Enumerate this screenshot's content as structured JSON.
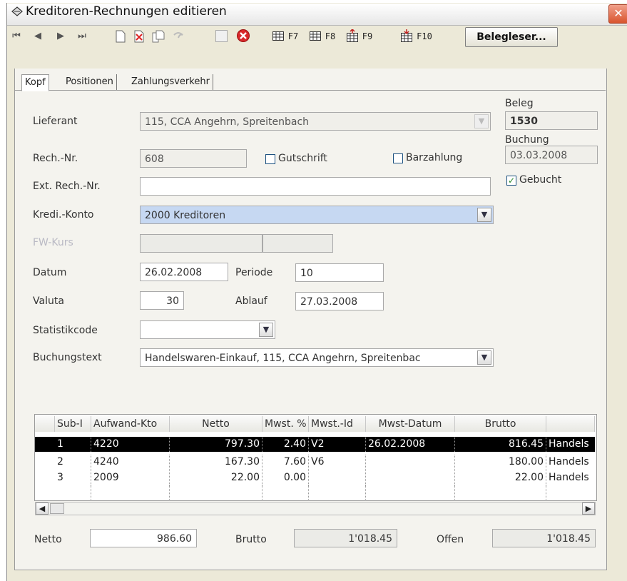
{
  "window": {
    "title": "Kreditoren-Rechnungen editieren",
    "close_symbol": "✕"
  },
  "toolbar": {
    "nav_first": "⏮",
    "nav_prev": "◀",
    "nav_next": "▶",
    "nav_last": "⏭",
    "f7": "F7",
    "f8": "F8",
    "f9": "F9",
    "f10": "F10",
    "beleg_button": "Belegleser..."
  },
  "tabs": [
    {
      "label": "Kopf",
      "active": true
    },
    {
      "label": "Positionen",
      "active": false
    },
    {
      "label": "Zahlungsverkehr",
      "active": false
    }
  ],
  "form": {
    "lieferant_label": "Lieferant",
    "lieferant_value": "115, CCA Angehrn, Spreitenbach",
    "rech_nr_label": "Rech.-Nr.",
    "rech_nr_value": "608",
    "gutschrift_label": "Gutschrift",
    "barzahlung_label": "Barzahlung",
    "ext_rech_nr_label": "Ext. Rech.-Nr.",
    "ext_rech_nr_value": "",
    "kredi_konto_label": "Kredi.-Konto",
    "kredi_konto_value": "2000 Kreditoren",
    "fw_kurs_label": "FW-Kurs",
    "datum_label": "Datum",
    "datum_value": "26.02.2008",
    "periode_label": "Periode",
    "periode_value": "10",
    "valuta_label": "Valuta",
    "valuta_value": "30",
    "ablauf_label": "Ablauf",
    "ablauf_value": "27.03.2008",
    "statistikcode_label": "Statistikcode",
    "statistikcode_value": "",
    "buchungstext_label": "Buchungstext",
    "buchungstext_value": "Handelswaren-Einkauf, 115, CCA Angehrn, Spreitenbac"
  },
  "side": {
    "beleg_label": "Beleg",
    "beleg_value": "1530",
    "buchung_label": "Buchung",
    "buchung_value": "03.03.2008",
    "gebucht_label": "Gebucht",
    "gebucht_checked": true
  },
  "grid": {
    "columns": [
      "Sub-I",
      "Aufwand-Kto",
      "Netto",
      "Mwst. %",
      "Mwst.-Id",
      "Mwst-Datum",
      "Brutto",
      ""
    ],
    "rows": [
      {
        "sub": "1",
        "konto": "4220",
        "netto": "797.30",
        "mwst": "2.40",
        "mwst_id": "V2",
        "datum": "26.02.2008",
        "brutto": "816.45",
        "text": "Handels",
        "selected": true
      },
      {
        "sub": "2",
        "konto": "4240",
        "netto": "167.30",
        "mwst": "7.60",
        "mwst_id": "V6",
        "datum": "",
        "brutto": "180.00",
        "text": "Handels",
        "selected": false
      },
      {
        "sub": "3",
        "konto": "2009",
        "netto": "22.00",
        "mwst": "0.00",
        "mwst_id": "",
        "datum": "",
        "brutto": "22.00",
        "text": "Handels",
        "selected": false
      }
    ]
  },
  "totals": {
    "netto_label": "Netto",
    "netto_value": "986.60",
    "brutto_label": "Brutto",
    "brutto_value": "1'018.45",
    "offen_label": "Offen",
    "offen_value": "1'018.45"
  }
}
